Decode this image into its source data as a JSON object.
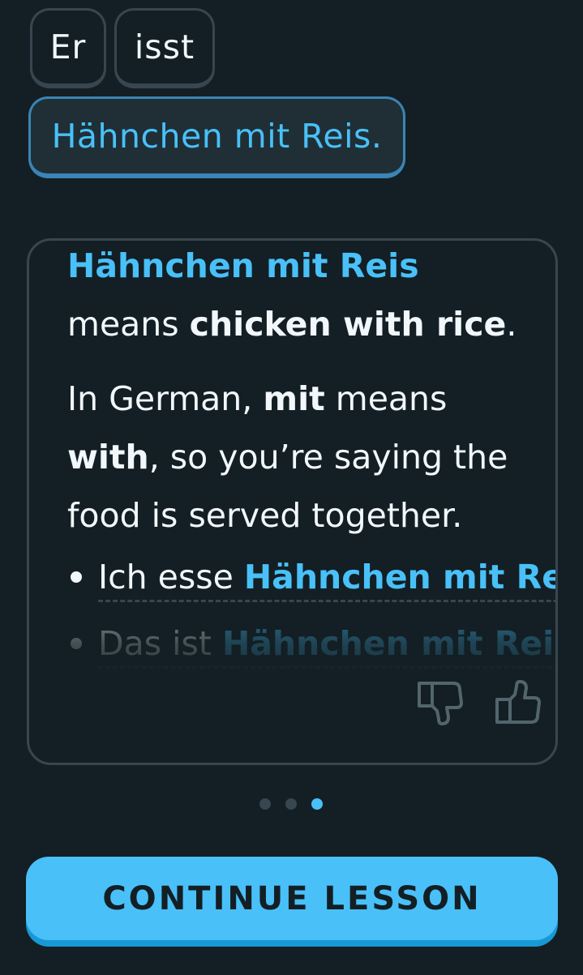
{
  "word_bank": {
    "placed_words": [
      "Er",
      "isst"
    ],
    "selected_phrase": "Hähnchen mit Reis."
  },
  "explanation": {
    "term": "Hähnchen mit Reis",
    "means_prefix": "means ",
    "translation": "chicken with rice",
    "means_suffix": ".",
    "p2_prefix": "In German, ",
    "p2_keyword": "mit",
    "p2_middle": " means",
    "p2_keyword2": "with",
    "p2_line2_rest": ", so you’re saying the",
    "p2_line3": "food is served together.",
    "examples": [
      {
        "prefix": "Ich esse ",
        "highlight": "Hähnchen mit Reis"
      },
      {
        "prefix": "Das ist ",
        "highlight": "Hähnchen mit Reis"
      }
    ]
  },
  "feedback": {
    "thumbs_down_icon": "thumbs-down-icon",
    "thumbs_up_icon": "thumbs-up-icon"
  },
  "pagination": {
    "total": 3,
    "current": 3
  },
  "continue_button": {
    "label": "CONTINUE LESSON"
  },
  "colors": {
    "background": "#131f24",
    "accent": "#49c0f8",
    "border": "#37464f",
    "text": "#f1f7fb"
  }
}
